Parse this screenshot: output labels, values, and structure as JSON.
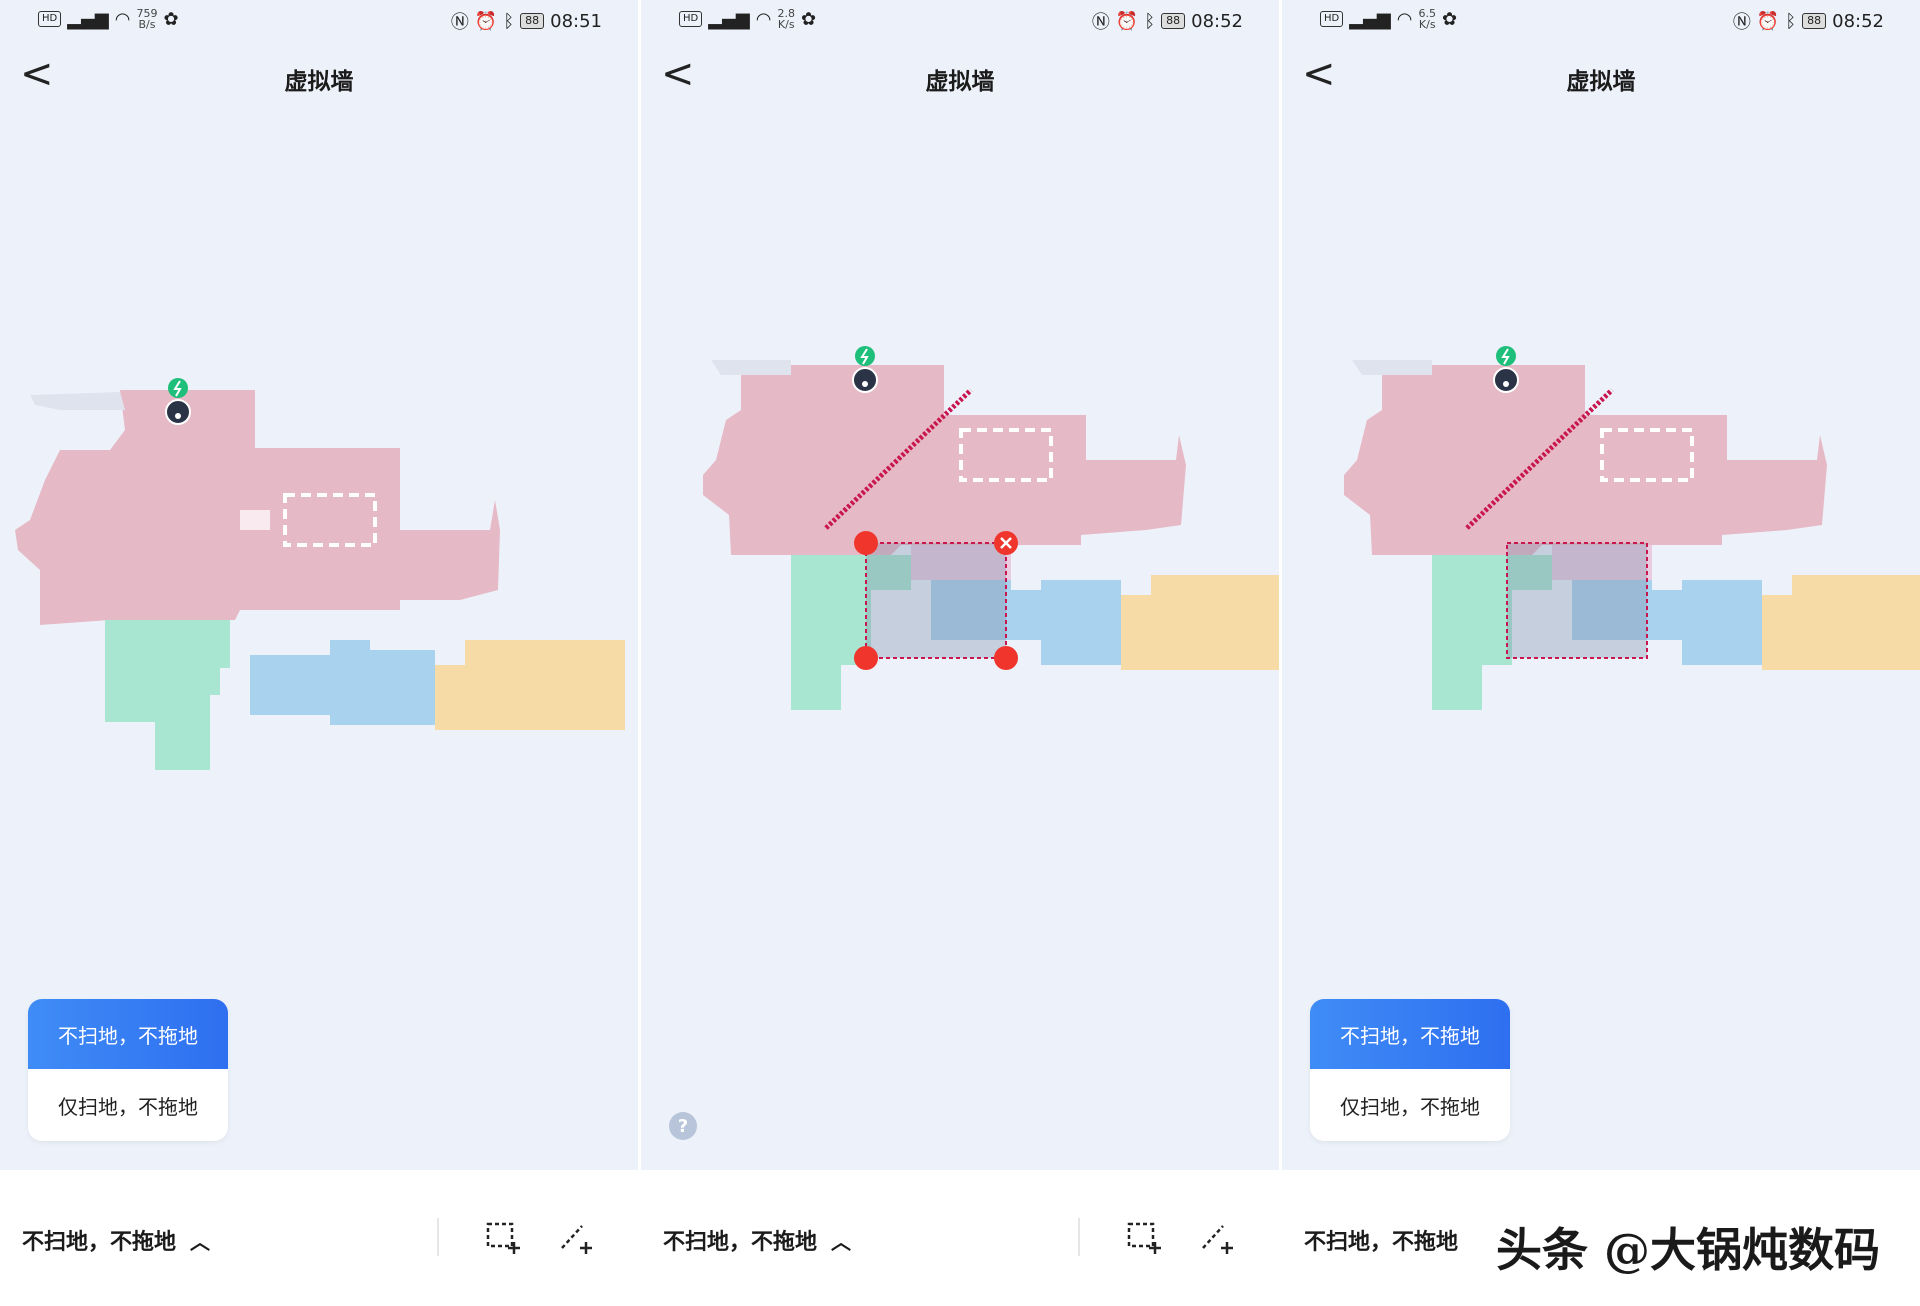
{
  "panels": [
    {
      "status": {
        "hd": "HD",
        "signal": "4G",
        "speed": "759",
        "speed_unit": "B/s",
        "time": "08:51",
        "battery": "88"
      },
      "title": "虚拟墙",
      "popup": {
        "option1": "不扫地，不拖地",
        "option2": "仅扫地，不拖地"
      },
      "bottom": {
        "mode": "不扫地，不拖地"
      }
    },
    {
      "status": {
        "hd": "HD",
        "signal": "4G",
        "speed": "2.8",
        "speed_unit": "K/s",
        "time": "08:52",
        "battery": "88"
      },
      "title": "虚拟墙",
      "help": "?",
      "bottom": {
        "mode": "不扫地，不拖地"
      }
    },
    {
      "status": {
        "hd": "HD",
        "signal": "4G",
        "speed": "6.5",
        "speed_unit": "K/s",
        "time": "08:52",
        "battery": "88"
      },
      "title": "虚拟墙",
      "popup": {
        "option1": "不扫地，不拖地",
        "option2": "仅扫地，不拖地"
      },
      "bottom": {
        "mode": "不扫地，不拖地"
      }
    }
  ],
  "watermark": "头条 @大锅炖数码",
  "colors": {
    "bg": "#edf2fa",
    "room_pink": "#e6b9c6",
    "room_green": "#a8e6d2",
    "room_blue": "#a9d2ee",
    "room_yellow": "#f6dba6",
    "wall": "#c8174f",
    "handle": "#f0352c",
    "button_blue": "#2e6ff0"
  }
}
